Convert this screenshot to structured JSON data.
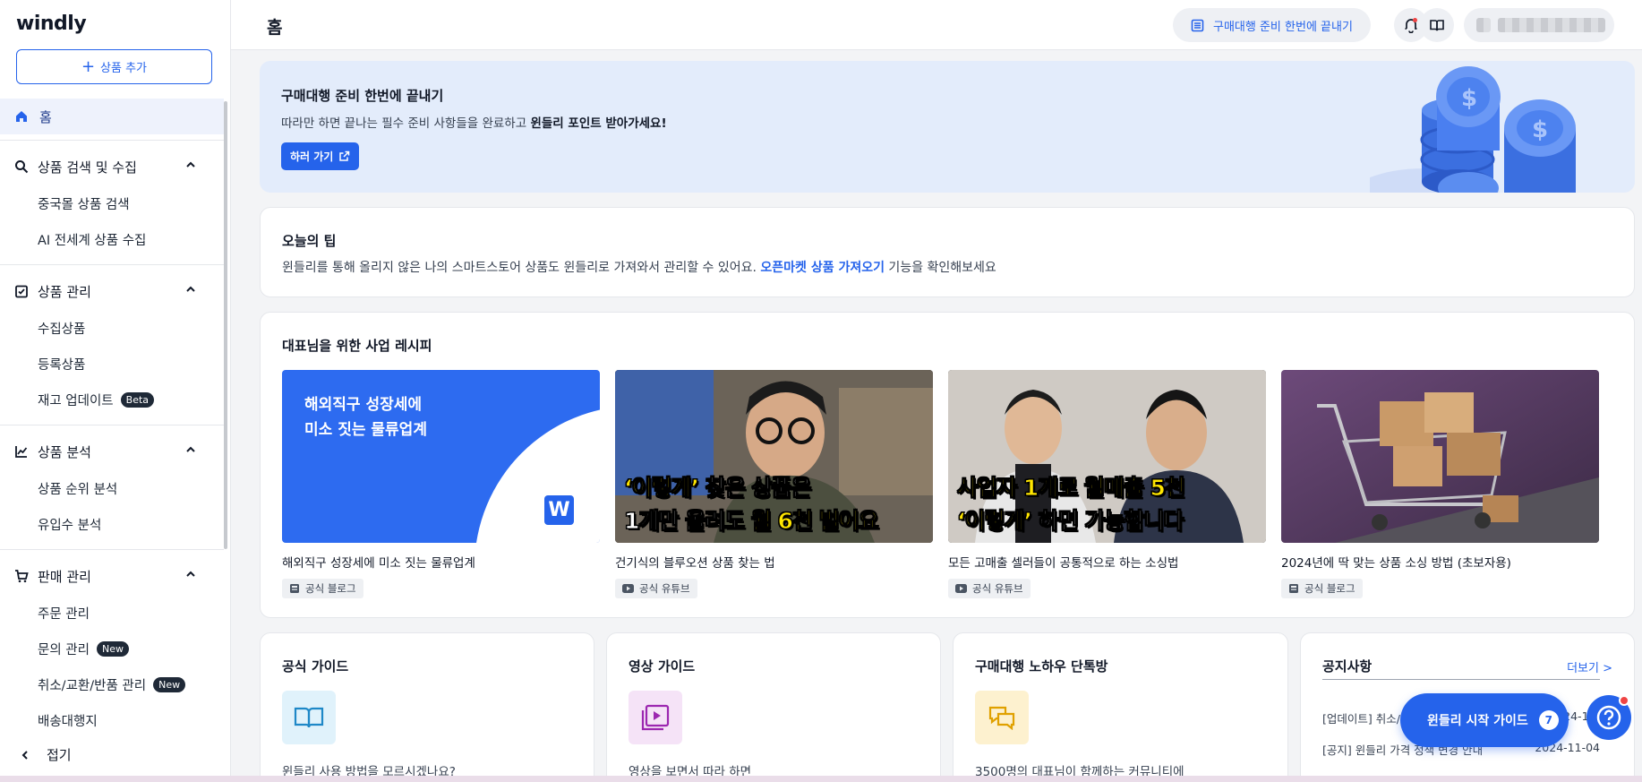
{
  "app": {
    "logo": "windly"
  },
  "sidebar": {
    "add_product": "상품 추가",
    "home": "홈",
    "sections": [
      {
        "label": "상품 검색 및 수집",
        "items": [
          {
            "label": "중국몰 상품 검색"
          },
          {
            "label": "AI 전세계 상품 수집"
          }
        ]
      },
      {
        "label": "상품 관리",
        "items": [
          {
            "label": "수집상품"
          },
          {
            "label": "등록상품"
          },
          {
            "label": "재고 업데이트",
            "badge": "Beta"
          }
        ]
      },
      {
        "label": "상품 분석",
        "items": [
          {
            "label": "상품 순위 분석"
          },
          {
            "label": "유입수 분석"
          }
        ]
      },
      {
        "label": "판매 관리",
        "items": [
          {
            "label": "주문 관리"
          },
          {
            "label": "문의 관리",
            "badge": "New"
          },
          {
            "label": "취소/교환/반품 관리",
            "badge": "New"
          },
          {
            "label": "배송대행지"
          }
        ]
      }
    ],
    "collapse": "접기"
  },
  "header": {
    "title": "홈",
    "guide_button": "구매대행 준비 한번에 끝내기"
  },
  "banner": {
    "title": "구매대행 준비 한번에 끝내기",
    "desc_prefix": "따라만 하면 끝나는 필수 준비 사항들을 완료하고 ",
    "desc_bold": "윈들리 포인트 받아가세요!",
    "button": "하러 가기"
  },
  "tip": {
    "title": "오늘의 팁",
    "text_prefix": "윈들리를 통해 올리지 않은 나의 스마트스토어 상품도 윈들리로 가져와서 관리할 수 있어요. ",
    "link": "오픈마켓 상품 가져오기",
    "text_suffix": " 기능을 확인해보세요"
  },
  "recipes": {
    "title": "대표님을 위한 사업 레시피",
    "cards": [
      {
        "title": "해외직구 성장세에 미소 짓는 물류업계",
        "tag": "공식 블로그",
        "thumb_line1": "해외직구 성장세에",
        "thumb_line2": "미소 짓는 물류업계",
        "thumb_logo": "W"
      },
      {
        "title": "건기식의 블루오션 상품 찾는 법",
        "tag": "공식 유튜브",
        "cap1_y": "‘이렇게’",
        "cap1_w": " 찾은 상품은",
        "cap2_w": "1개만 올려도 ",
        "cap2_y": "월 6천 벌어요"
      },
      {
        "title": "모든 고매출 셀러들이 공통적으로 하는 소싱법",
        "tag": "공식 유튜브",
        "cap1_y": "사업자 1개로 월매출 5천",
        "cap2_y": "‘이렇게’",
        "cap2_w": " 하면 가능합니다"
      },
      {
        "title": "2024년에 딱 맞는 상품 소싱 방법 (초보자용)",
        "tag": "공식 블로그"
      }
    ]
  },
  "guides": [
    {
      "title": "공식 가이드",
      "desc": "윈들리 사용 방법을 모르시겠나요?",
      "icon": "book-icon"
    },
    {
      "title": "영상 가이드",
      "desc": "영상을 보면서 따라 하면",
      "icon": "video-icon"
    },
    {
      "title": "구매대행 노하우 단톡방",
      "desc": "3500명의 대표님이 함께하는 커뮤니티에",
      "icon": "chat-icon"
    }
  ],
  "notices": {
    "title": "공지사항",
    "more": "더보기 >",
    "rows": [
      {
        "text": "[업데이트] 취소/교환/반품 관리",
        "date": "2024-11-"
      },
      {
        "text": "[공지] 윈들리 가격 정책 변경 안내",
        "date": "2024-11-04"
      }
    ]
  },
  "floating": {
    "start_guide": "윈들리 시작 가이드",
    "count": "7"
  },
  "colors": {
    "accent": "#2563eb",
    "banner_bg": "#e3ecfb",
    "badge_bg": "#1f2937"
  }
}
